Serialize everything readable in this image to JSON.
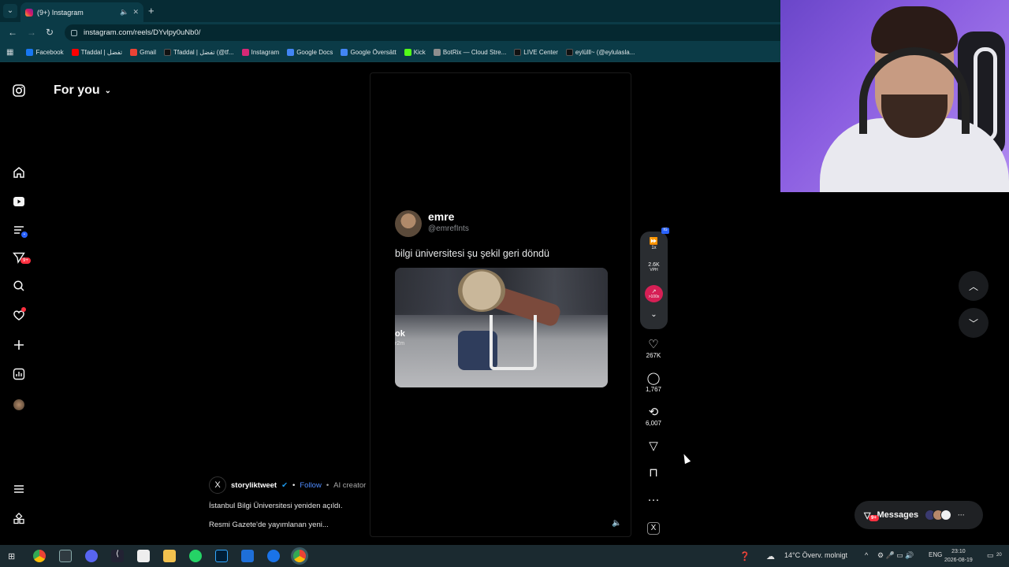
{
  "browser": {
    "tab_title": "(9+) Instagram",
    "new_tab": "+",
    "url": "instagram.com/reels/DYvlpy0uNb0/",
    "bookmarks": [
      {
        "label": "Facebook",
        "color": "#1877f2"
      },
      {
        "label": "Tfaddal | تفضل",
        "color": "#ff0000"
      },
      {
        "label": "Gmail",
        "color": "#ea4335"
      },
      {
        "label": "Tfaddal | تفضل (@tf...",
        "color": "#111111"
      },
      {
        "label": "Instagram",
        "color": "#d62976"
      },
      {
        "label": "Google Docs",
        "color": "#4285f4"
      },
      {
        "label": "Google Översätt",
        "color": "#4285f4"
      },
      {
        "label": "Kick",
        "color": "#53fc18"
      },
      {
        "label": "BotRix — Cloud Stre...",
        "color": "#8e8e8e"
      },
      {
        "label": "LIVE Center",
        "color": "#111111"
      },
      {
        "label": "eylülll~ (@eylulasla...",
        "color": "#111111"
      }
    ]
  },
  "sidebar": {
    "header": "For you",
    "notifications_badge": "9+"
  },
  "post": {
    "name": "emre",
    "handle": "@emrefInts",
    "text": "bilgi üniversitesi şu şekil geri döndü",
    "video_watermark": "ok",
    "video_watermark_sub": "r2m"
  },
  "overlay_pill": {
    "speed": "1x",
    "vph_value": "2.6K",
    "vph_label": "VPH",
    "hot_label": ">100x",
    "tag": "IG"
  },
  "actions": {
    "likes": "267K",
    "comments": "1,767",
    "reposts": "6,007"
  },
  "author": {
    "name": "storyliktweet",
    "follow": "Follow",
    "tag": "AI creator",
    "caption_1": "İstanbul Bilgi Üniversitesi yeniden açıldı.",
    "caption_2": "Resmi Gazete'de yayımlanan yeni..."
  },
  "messages": {
    "label": "Messages",
    "badge": "9+"
  },
  "taskbar": {
    "weather": "14°C  Överv. molnigt",
    "lang": "ENG",
    "time": "23:10",
    "date": "2026-08-19",
    "notif": "20"
  }
}
